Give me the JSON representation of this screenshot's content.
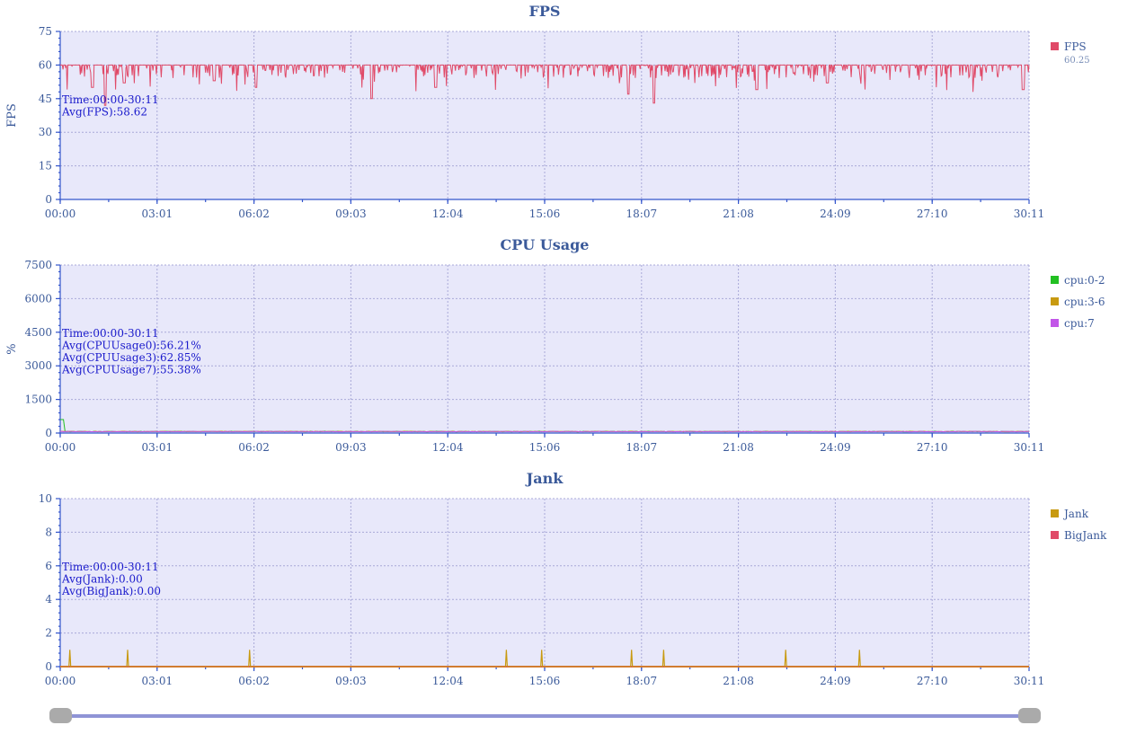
{
  "x_labels": [
    "00:00",
    "03:01",
    "06:02",
    "09:03",
    "12:04",
    "15:06",
    "18:07",
    "21:08",
    "24:09",
    "27:10",
    "30:11"
  ],
  "colors": {
    "fps": "#e04a68",
    "cpu0": "#22c022",
    "cpu3": "#c89a10",
    "cpu7": "#c256e8",
    "jank": "#c89a10",
    "bigjank": "#e04a68"
  },
  "charts": [
    {
      "id": "fps",
      "title": "FPS",
      "ylabel": "FPS",
      "ymax": 75,
      "yticks": [
        "0",
        "15",
        "30",
        "45",
        "60",
        "75"
      ],
      "annotations": [
        "Time:00:00-30:11",
        "Avg(FPS):58.62"
      ],
      "legend": [
        {
          "label": "FPS",
          "sub": "60.25",
          "color": "#e04a68"
        }
      ]
    },
    {
      "id": "cpu",
      "title": "CPU Usage",
      "ylabel": "%",
      "ymax": 7500,
      "yticks": [
        "0",
        "1500",
        "3000",
        "4500",
        "6000",
        "7500"
      ],
      "annotations": [
        "Time:00:00-30:11",
        "Avg(CPUUsage0):56.21%",
        "Avg(CPUUsage3):62.85%",
        "Avg(CPUUsage7):55.38%"
      ],
      "legend": [
        {
          "label": "cpu:0-2",
          "color": "#22c022"
        },
        {
          "label": "cpu:3-6",
          "color": "#c89a10"
        },
        {
          "label": "cpu:7",
          "color": "#c256e8"
        }
      ]
    },
    {
      "id": "jank",
      "title": "Jank",
      "ylabel": "",
      "ymax": 10,
      "yticks": [
        "0",
        "2",
        "4",
        "6",
        "8",
        "10"
      ],
      "annotations": [
        "Time:00:00-30:11",
        "Avg(Jank):0.00",
        "Avg(BigJank):0.00"
      ],
      "legend": [
        {
          "label": "Jank",
          "color": "#c89a10"
        },
        {
          "label": "BigJank",
          "color": "#e04a68"
        }
      ]
    }
  ],
  "chart_data": [
    {
      "type": "line",
      "title": "FPS",
      "ylabel": "FPS",
      "ylim": [
        0,
        75
      ],
      "x_range": [
        "00:00",
        "30:11"
      ],
      "series": [
        {
          "name": "FPS",
          "average": 58.62,
          "typical": 60,
          "min_observed": 43
        }
      ],
      "fps_dips": [
        {
          "t": 1.0,
          "v": 50
        },
        {
          "t": 1.4,
          "v": 42
        },
        {
          "t": 2.0,
          "v": 52
        },
        {
          "t": 4.8,
          "v": 53
        },
        {
          "t": 6.1,
          "v": 50
        },
        {
          "t": 9.7,
          "v": 45
        },
        {
          "t": 11.7,
          "v": 50
        },
        {
          "t": 17.7,
          "v": 47
        },
        {
          "t": 18.5,
          "v": 43
        },
        {
          "t": 21.7,
          "v": 49
        },
        {
          "t": 23.9,
          "v": 52
        },
        {
          "t": 30.0,
          "v": 49
        }
      ]
    },
    {
      "type": "line",
      "title": "CPU Usage",
      "ylabel": "%",
      "ylim": [
        0,
        7500
      ],
      "x_range": [
        "00:00",
        "30:11"
      ],
      "series": [
        {
          "name": "cpu:0-2",
          "average": 56.21
        },
        {
          "name": "cpu:3-6",
          "average": 62.85
        },
        {
          "name": "cpu:7",
          "average": 55.38
        }
      ]
    },
    {
      "type": "line",
      "title": "Jank",
      "ylim": [
        0,
        10
      ],
      "x_range": [
        "00:00",
        "30:11"
      ],
      "series": [
        {
          "name": "Jank",
          "average": 0.0,
          "spikes_minutes": [
            0.3,
            2.1,
            5.9,
            13.9,
            15.0,
            17.8,
            18.8,
            22.6,
            24.9
          ],
          "spike_value": 1
        },
        {
          "name": "BigJank",
          "average": 0.0
        }
      ]
    }
  ]
}
